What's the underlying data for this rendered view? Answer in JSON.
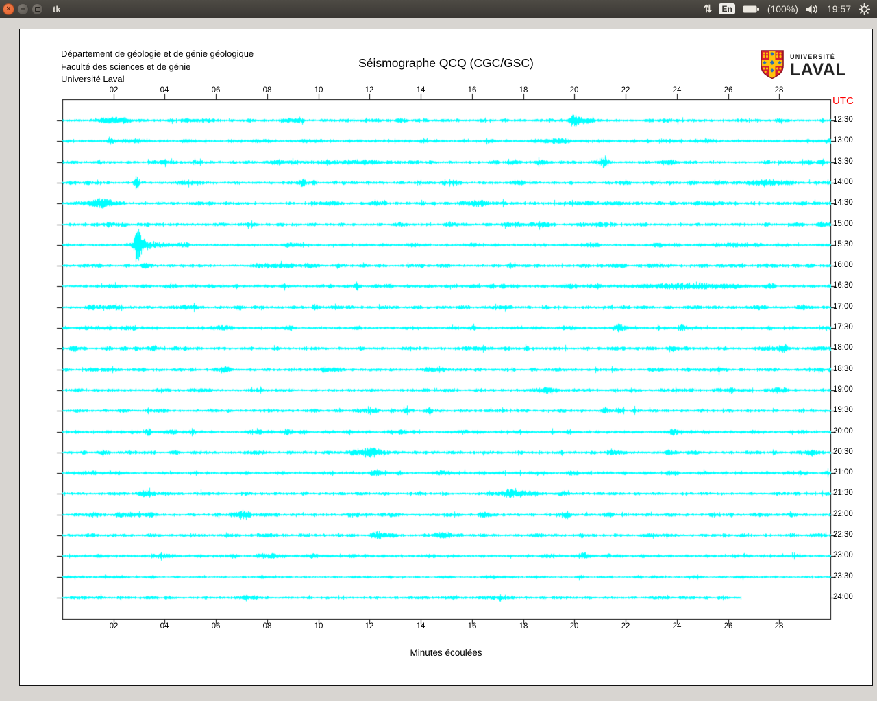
{
  "titlebar": {
    "title": "tk",
    "indicators": {
      "arrows_glyph": "⇅",
      "keyboard_layout": "En",
      "battery_text": "(100%)",
      "clock": "19:57"
    }
  },
  "window": {
    "institution_lines": [
      "Département de géologie et de génie géologique",
      "Faculté des sciences et de génie",
      "Université Laval"
    ],
    "plot_title": "Séismographe QCQ (CGC/GSC)",
    "logo": {
      "line1": "UNIVERSITÉ",
      "line2": "LAVAL",
      "shield_red": "#d71f2f",
      "shield_gold": "#ffc20e",
      "shield_blue": "#2a6db5"
    },
    "utc_label": "UTC",
    "utc_color": "#ff0000",
    "xlabel": "Minutes écoulées"
  },
  "chart_data": {
    "type": "line",
    "subtype": "helicorder-seismogram",
    "station": "QCQ (CGC/GSC)",
    "trace_color": "#00ffff",
    "x_axis": {
      "label": "Minutes écoulées",
      "range": [
        0,
        30
      ],
      "tick_step_minutes": 2,
      "tick_labels": [
        "02",
        "04",
        "06",
        "08",
        "10",
        "12",
        "14",
        "16",
        "18",
        "20",
        "22",
        "24",
        "26",
        "28"
      ]
    },
    "y_axis": {
      "label": "UTC",
      "lines_top_to_bottom": "12:30 to 24:00 in 30-minute steps"
    },
    "traces": [
      {
        "utc": "12:30",
        "base": 1,
        "events": [
          {
            "m": 1.8,
            "a": 3,
            "w": 0.15
          },
          {
            "m": 20.0,
            "a": 9,
            "w": 0.1
          },
          {
            "m": 20.25,
            "a": 4,
            "w": 0.3
          }
        ]
      },
      {
        "utc": "13:00",
        "base": 1,
        "events": [
          {
            "m": 1.85,
            "a": 5,
            "w": 0.08
          },
          {
            "m": 19.6,
            "a": 3,
            "w": 0.2
          }
        ]
      },
      {
        "utc": "13:30",
        "base": 1,
        "events": [
          {
            "m": 11.2,
            "a": 2.5,
            "w": 1.2
          },
          {
            "m": 21.2,
            "a": 7,
            "w": 0.12
          },
          {
            "m": 23.6,
            "a": 3,
            "w": 0.2
          }
        ]
      },
      {
        "utc": "14:00",
        "base": 1,
        "events": [
          {
            "m": 2.9,
            "a": 11,
            "w": 0.07
          },
          {
            "m": 9.3,
            "a": 3.5,
            "w": 0.12
          },
          {
            "m": 22.0,
            "a": 3,
            "w": 0.15
          },
          {
            "m": 27.5,
            "a": 4,
            "w": 0.4
          }
        ]
      },
      {
        "utc": "14:30",
        "base": 1,
        "events": [
          {
            "m": 1.35,
            "a": 4.5,
            "w": 0.3
          },
          {
            "m": 16.0,
            "a": 3,
            "w": 0.3
          }
        ]
      },
      {
        "utc": "15:00",
        "base": 1,
        "events": [
          {
            "m": 20.3,
            "a": 3.5,
            "w": 0.12
          }
        ]
      },
      {
        "utc": "15:30",
        "base": 1,
        "events": [
          {
            "m": 2.92,
            "a": 21,
            "w": 0.09
          },
          {
            "m": 3.05,
            "a": 8,
            "w": 0.25
          }
        ]
      },
      {
        "utc": "16:00",
        "base": 1,
        "events": [
          {
            "m": 8.0,
            "a": 2.5,
            "w": 0.3
          }
        ]
      },
      {
        "utc": "16:30",
        "base": 1,
        "events": [
          {
            "m": 11.48,
            "a": 9,
            "w": 0.07
          },
          {
            "m": 19.7,
            "a": 3.5,
            "w": 0.2
          },
          {
            "m": 24.3,
            "a": 3.5,
            "w": 1.4
          }
        ]
      },
      {
        "utc": "17:00",
        "base": 1,
        "events": [
          {
            "m": 6.9,
            "a": 4.5,
            "w": 0.1
          },
          {
            "m": 9.9,
            "a": 3.5,
            "w": 0.1
          }
        ]
      },
      {
        "utc": "17:30",
        "base": 1,
        "events": [
          {
            "m": 21.7,
            "a": 3.5,
            "w": 0.15
          },
          {
            "m": 24.2,
            "a": 3.5,
            "w": 0.12
          }
        ]
      },
      {
        "utc": "18:00",
        "base": 1,
        "events": [
          {
            "m": 0.45,
            "a": 5.5,
            "w": 0.1
          },
          {
            "m": 28.2,
            "a": 3.5,
            "w": 0.15
          }
        ]
      },
      {
        "utc": "18:30",
        "base": 1,
        "events": [
          {
            "m": 6.3,
            "a": 2.5,
            "w": 0.25
          }
        ]
      },
      {
        "utc": "19:00",
        "base": 1,
        "events": [
          {
            "m": 26.1,
            "a": 4,
            "w": 0.1
          }
        ]
      },
      {
        "utc": "19:30",
        "base": 1,
        "events": [
          {
            "m": 14.32,
            "a": 8,
            "w": 0.08
          },
          {
            "m": 21.2,
            "a": 3.5,
            "w": 0.15
          }
        ]
      },
      {
        "utc": "20:00",
        "base": 1,
        "events": [
          {
            "m": 3.35,
            "a": 4.5,
            "w": 0.1
          },
          {
            "m": 8.8,
            "a": 3,
            "w": 0.12
          }
        ]
      },
      {
        "utc": "20:30",
        "base": 1,
        "events": [
          {
            "m": 12.05,
            "a": 6,
            "w": 0.3
          },
          {
            "m": 29.2,
            "a": 4,
            "w": 0.12
          }
        ]
      },
      {
        "utc": "21:00",
        "base": 1,
        "events": [
          {
            "m": 12.3,
            "a": 3.5,
            "w": 0.2
          }
        ]
      },
      {
        "utc": "21:30",
        "base": 1,
        "events": [
          {
            "m": 17.6,
            "a": 4.5,
            "w": 0.5
          }
        ]
      },
      {
        "utc": "22:00",
        "base": 1,
        "events": [
          {
            "m": 7.0,
            "a": 4.5,
            "w": 0.25
          },
          {
            "m": 16.4,
            "a": 4,
            "w": 0.12
          },
          {
            "m": 19.7,
            "a": 4.5,
            "w": 0.12
          }
        ]
      },
      {
        "utc": "22:30",
        "base": 1,
        "events": [
          {
            "m": 12.3,
            "a": 3.5,
            "w": 0.15
          }
        ]
      },
      {
        "utc": "23:00",
        "base": 1,
        "events": [
          {
            "m": 20.3,
            "a": 3.5,
            "w": 0.12
          }
        ]
      },
      {
        "utc": "23:30",
        "base": 0.7,
        "events": [
          {
            "m": 20.2,
            "a": 3.5,
            "w": 0.08
          }
        ]
      },
      {
        "utc": "24:00",
        "base": 0.9,
        "end": 26.5,
        "events": []
      }
    ]
  }
}
